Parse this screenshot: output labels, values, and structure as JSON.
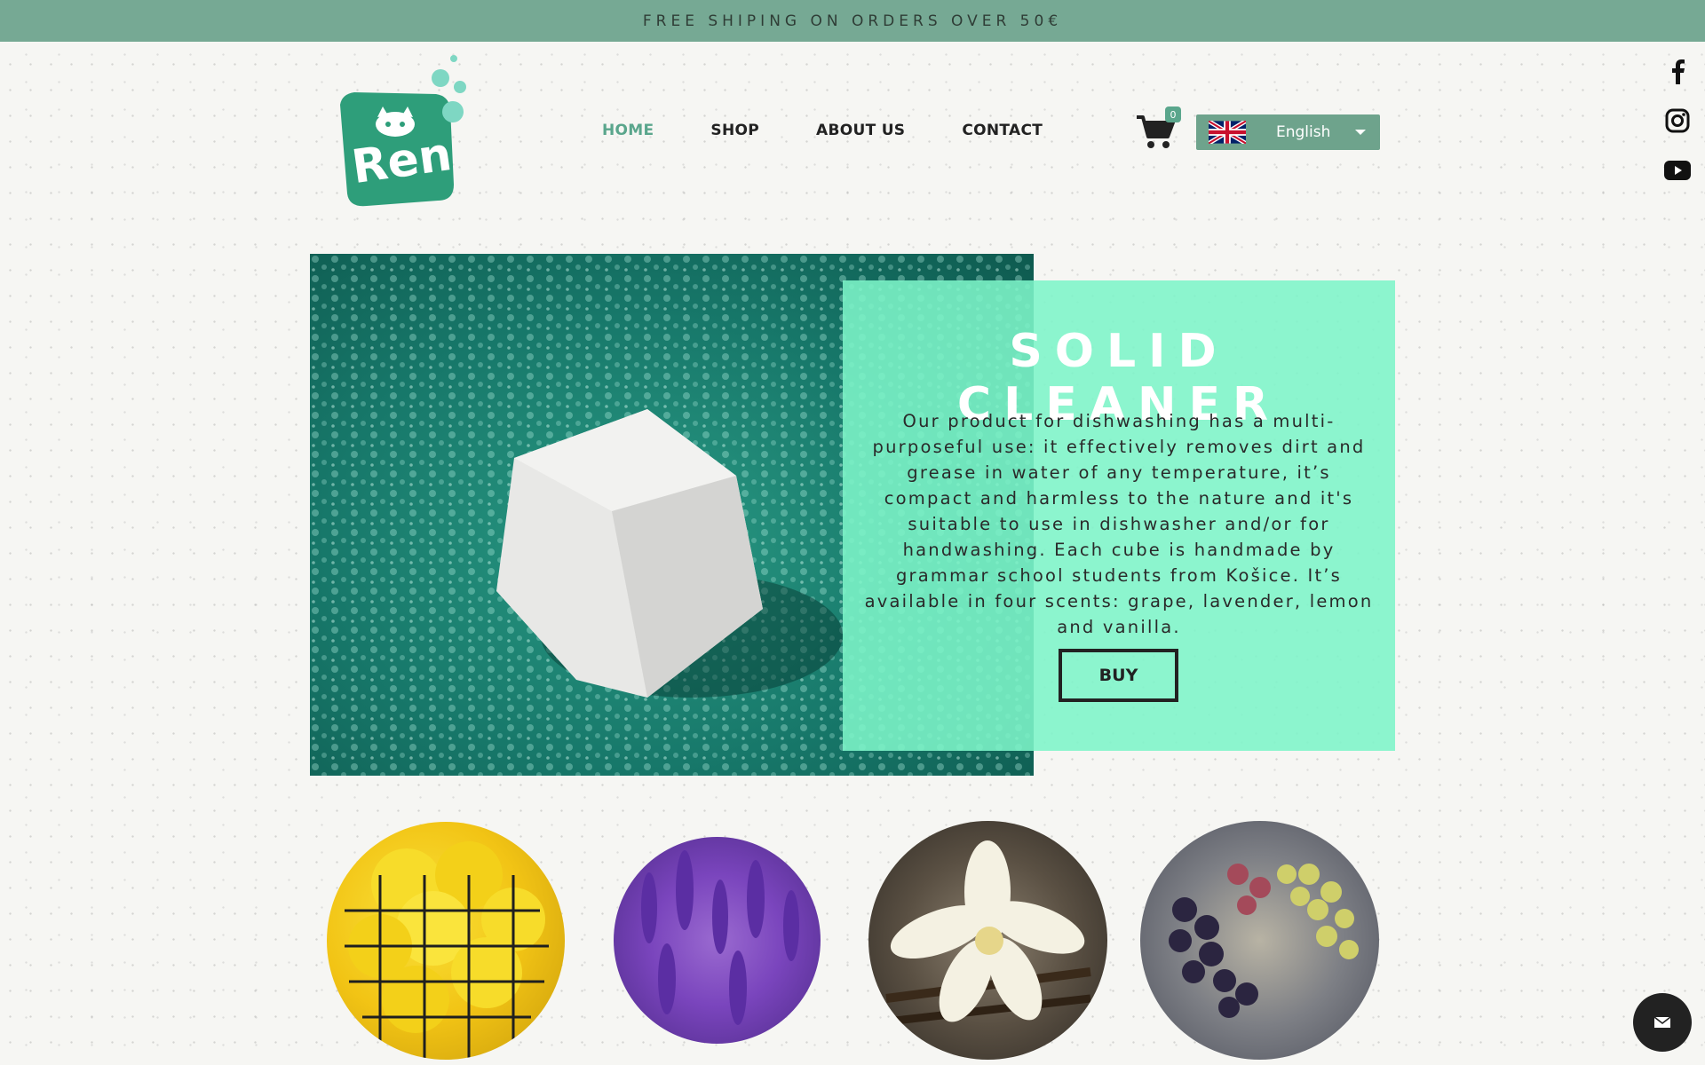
{
  "banner": {
    "text": "FREE SHIPING ON ORDERS OVER 50€"
  },
  "logo": {
    "text": "Ren",
    "brand_color": "#2e9e7a"
  },
  "nav": {
    "items": [
      {
        "label": "HOME",
        "active": true
      },
      {
        "label": "SHOP",
        "active": false
      },
      {
        "label": "ABOUT US",
        "active": false
      },
      {
        "label": "CONTACT",
        "active": false
      }
    ]
  },
  "cart": {
    "count": "0",
    "icon": "cart-icon"
  },
  "language": {
    "selected": "English",
    "flag": "uk-flag-icon"
  },
  "social": [
    "facebook-icon",
    "instagram-icon",
    "youtube-icon"
  ],
  "hero": {
    "title": "SOLID CLEANER",
    "description": "Our product for dishwashing has a multi-purposeful use: it effectively removes dirt and grease in water of any temperature, it’s compact and harmless to the nature and it's suitable to use in dishwasher and/or for handwashing. Each cube is handmade by grammar school students from Košice. It’s available in four scents: grape, lavender, lemon and vanilla.",
    "button": "BUY"
  },
  "scents": [
    "lemon",
    "lavender",
    "vanilla",
    "grape"
  ],
  "colors": {
    "banner": "#76a994",
    "accent": "#5aa68c",
    "panel": "#7df5c8",
    "text": "#222222"
  }
}
